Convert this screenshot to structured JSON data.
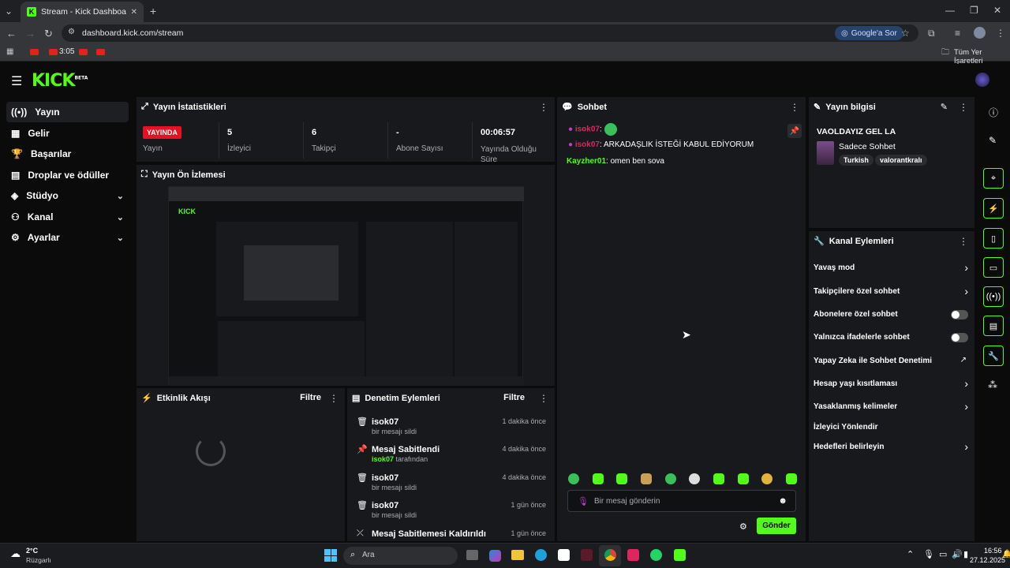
{
  "browser": {
    "tab_title": "Stream - Kick Dashboard",
    "url": "dashboard.kick.com/stream",
    "google_btn": "Google'a Sor",
    "bookmark_time": "3:05",
    "all_bookmarks": "Tüm Yer İşaretleri"
  },
  "header": {
    "logo": "KICK",
    "logo_badge": "BETA"
  },
  "sidebar": {
    "items": [
      {
        "label": "Yayın"
      },
      {
        "label": "Gelir"
      },
      {
        "label": "Başarılar"
      },
      {
        "label": "Droplar ve ödüller"
      },
      {
        "label": "Stüdyo"
      },
      {
        "label": "Kanal"
      },
      {
        "label": "Ayarlar"
      }
    ]
  },
  "stats": {
    "title": "Yayın İstatistikleri",
    "live_badge": "YAYINDA",
    "live_label": "Yayın",
    "viewers_value": "5",
    "viewers_label": "İzleyici",
    "followers_value": "6",
    "followers_label": "Takipçi",
    "subs_value": "-",
    "subs_label": "Abone Sayısı",
    "duration_value": "00:06:57",
    "duration_label": "Yayında Olduğu Süre"
  },
  "preview": {
    "title": "Yayın Ön İzlemesi"
  },
  "activity": {
    "title": "Etkinlik Akışı",
    "filter": "Filtre"
  },
  "moderation": {
    "title": "Denetim Eylemleri",
    "filter": "Filtre",
    "items": [
      {
        "title": "isok07",
        "sub_pre": "",
        "sub": "bir mesajı sildi",
        "time": "1 dakika önce"
      },
      {
        "title": "Mesaj Sabitlendi",
        "sub_pre": "isok07",
        "sub": "tarafından",
        "time": "4 dakika önce"
      },
      {
        "title": "isok07",
        "sub_pre": "",
        "sub": "bir mesajı sildi",
        "time": "4 dakika önce"
      },
      {
        "title": "isok07",
        "sub_pre": "",
        "sub": "bir mesajı sildi",
        "time": "1 gün önce"
      },
      {
        "title": "Mesaj Sabitlemesi Kaldırıldı",
        "sub_pre": "",
        "sub": "",
        "time": "1 gün önce"
      }
    ]
  },
  "chat": {
    "title": "Sohbet",
    "messages": [
      {
        "user": "isok07",
        "text": "",
        "user_color": "#e0245e"
      },
      {
        "user": "isok07",
        "text": ": ARKADAŞLIK İSTEĞİ KABUL EDİYORUM",
        "user_color": "#e0245e"
      },
      {
        "user": "Kayzher01",
        "text": ": omen ben sova",
        "user_color": "#53fc18"
      }
    ],
    "input_placeholder": "Bir mesaj gönderin",
    "send": "Gönder"
  },
  "stream_info": {
    "title": "Yayın bilgisi",
    "stream_title": "VAOLDAYIZ GEL LA",
    "category": "Sadece Sohbet",
    "tags": [
      "Turkish",
      "valorantkralı"
    ]
  },
  "channel_actions": {
    "title": "Kanal Eylemleri",
    "items": [
      {
        "label": "Yavaş mod",
        "control": "chevron"
      },
      {
        "label": "Takipçilere özel sohbet",
        "control": "chevron"
      },
      {
        "label": "Abonelere özel sohbet",
        "control": "toggle"
      },
      {
        "label": "Yalnızca ifadelerle sohbet",
        "control": "toggle"
      },
      {
        "label": "Yapay Zeka ile Sohbet Denetimi",
        "control": "external"
      },
      {
        "label": "Hesap yaşı kısıtlaması",
        "control": "chevron"
      },
      {
        "label": "Yasaklanmış kelimeler",
        "control": "chevron"
      },
      {
        "label": "İzleyici Yönlendir",
        "control": "none"
      },
      {
        "label": "Hedefleri belirleyin",
        "control": "chevron"
      }
    ]
  },
  "taskbar": {
    "weather_temp": "2°C",
    "weather_desc": "Rüzgarlı",
    "search": "Ara",
    "time": "16:56",
    "date": "27.12.2025"
  }
}
